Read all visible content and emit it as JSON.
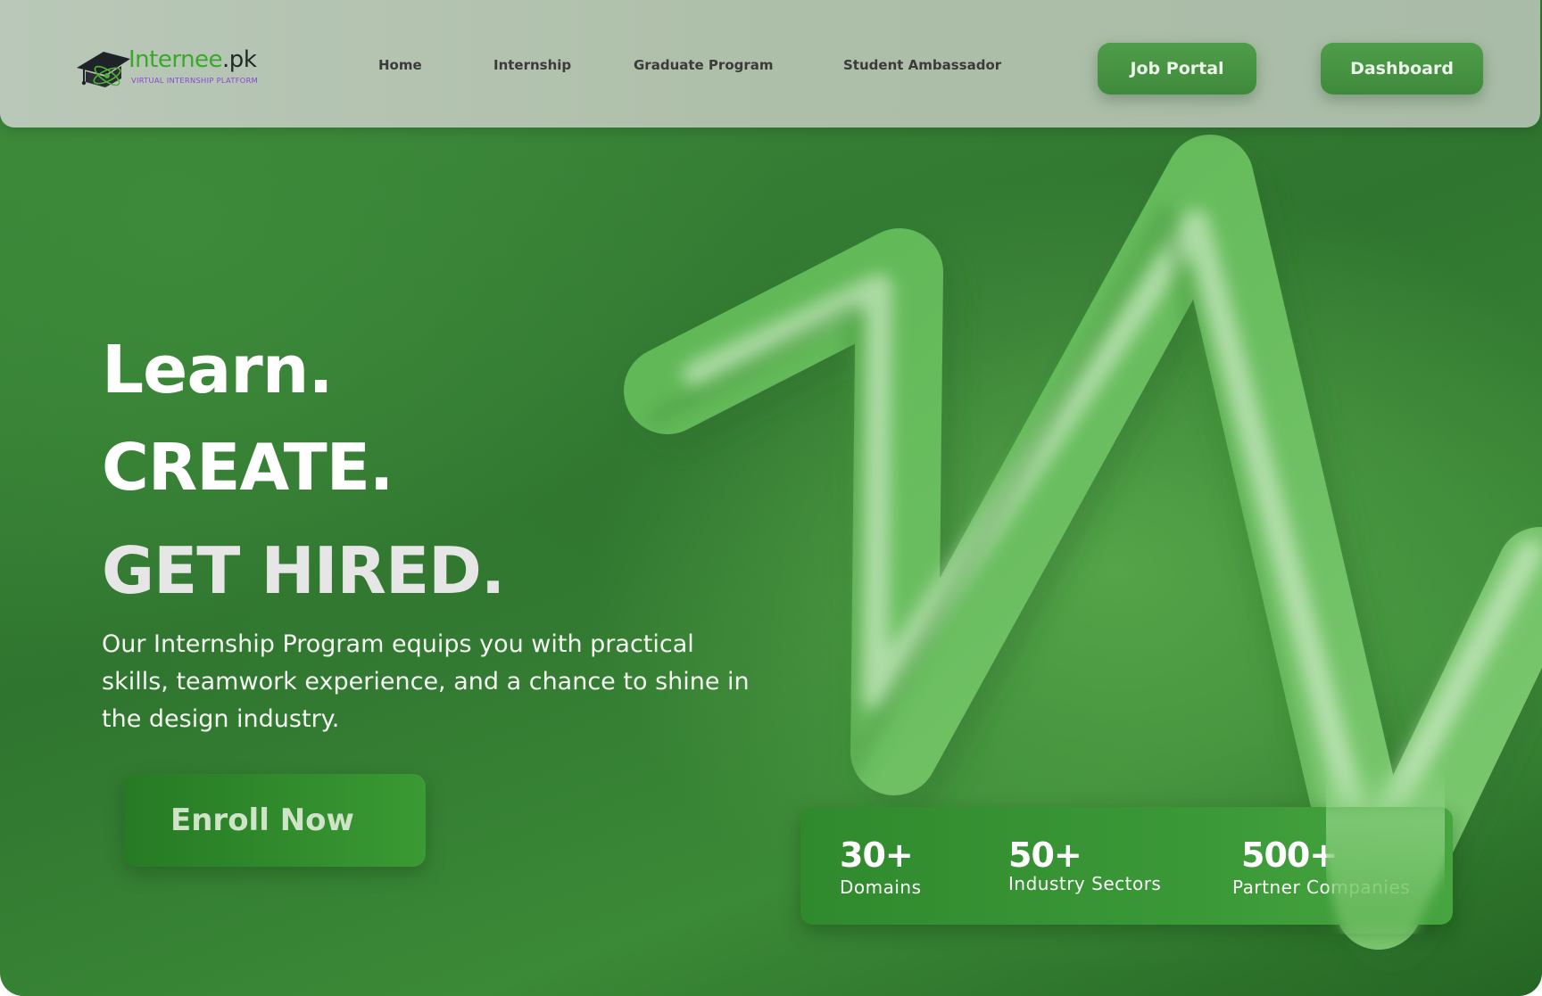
{
  "brand": {
    "name": "Internee",
    "tld": ".pk",
    "tagline": "VIRTUAL INTERNSHIP PLATFORM",
    "logo_icon": "graduation-cap-atom-icon"
  },
  "nav": {
    "links": [
      "Home",
      "Internship",
      "Graduate Program",
      "Student Ambassador"
    ],
    "job_portal": "Job Portal",
    "dashboard": "Dashboard"
  },
  "hero": {
    "line1": "Learn.",
    "line2": "CREATE.",
    "line3": "GET HIRED.",
    "description": "Our Internship Program equips you with practical skills, teamwork experience, and a chance to shine in the design industry.",
    "cta": "Enroll Now"
  },
  "stats": [
    {
      "value": "30+",
      "label": "Domains"
    },
    {
      "value": "50+",
      "label": "Industry Sectors"
    },
    {
      "value": "500+",
      "label": "Partner Companies"
    }
  ],
  "colors": {
    "primary_green": "#3e8a3b",
    "brand_green": "#3aa82a",
    "tagline_purple": "#8a46d8",
    "navbar_bg": "#b1c2ae"
  }
}
